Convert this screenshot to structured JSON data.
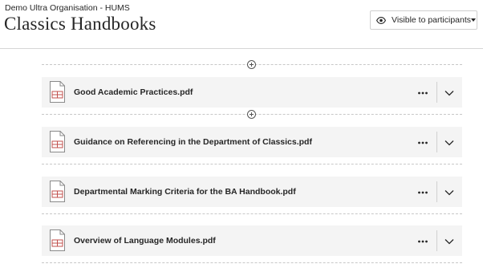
{
  "header": {
    "organisation": "Demo Ultra Organisation - HUMS",
    "title": "Classics Handbooks",
    "visibility_label": "Visible to participants",
    "visibility_icon": "eye-icon"
  },
  "content": {
    "items": [
      {
        "title": "Good Academic Practices.pdf",
        "icon": "pdf-file-icon"
      },
      {
        "title": "Guidance on Referencing in the Department of Classics.pdf",
        "icon": "pdf-file-icon"
      },
      {
        "title": "Departmental Marking Criteria for the BA Handbook.pdf",
        "icon": "pdf-file-icon"
      },
      {
        "title": "Overview of Language Modules.pdf",
        "icon": "pdf-file-icon"
      }
    ],
    "more_icon": "more-options-icon",
    "expand_icon": "chevron-down-icon",
    "add_icon": "add-content-icon"
  },
  "colors": {
    "text": "#262626",
    "item_background": "#f4f4f4",
    "divider": "#c8c8c8",
    "file_icon_accent": "#c0504d"
  }
}
